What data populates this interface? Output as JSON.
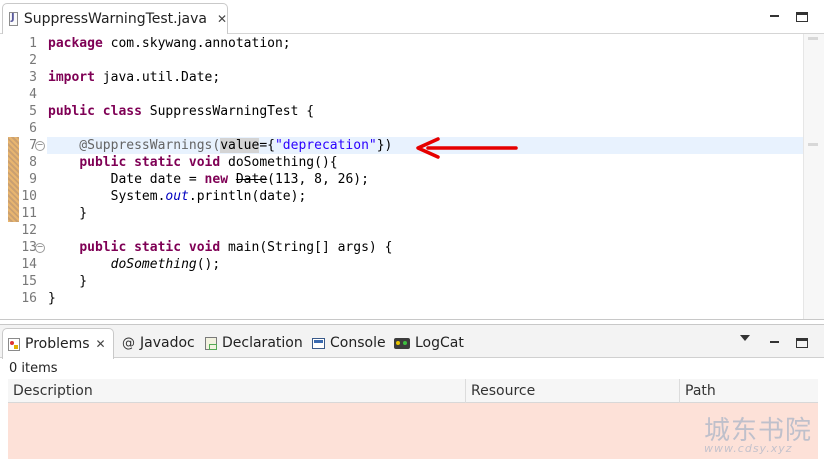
{
  "editor": {
    "tab_title": "SuppressWarningTest.java",
    "close_glyph": "✕",
    "lines": [
      {
        "n": "1"
      },
      {
        "n": "2"
      },
      {
        "n": "3"
      },
      {
        "n": "4"
      },
      {
        "n": "5"
      },
      {
        "n": "6"
      },
      {
        "n": "7"
      },
      {
        "n": "8"
      },
      {
        "n": "9"
      },
      {
        "n": "10"
      },
      {
        "n": "11"
      },
      {
        "n": "12"
      },
      {
        "n": "13"
      },
      {
        "n": "14"
      },
      {
        "n": "15"
      },
      {
        "n": "16"
      }
    ],
    "code": {
      "l1_kw": "package",
      "l1_rest": " com.skywang.annotation;",
      "l3_kw": "import",
      "l3_rest": " java.util.Date;",
      "l5_kw": "public class",
      "l5_rest": " SuppressWarningTest {",
      "l7_ann": "    @SuppressWarnings(",
      "l7_value": "value",
      "l7_eq": "={",
      "l7_str": "\"deprecation\"",
      "l7_end": "})",
      "l8_indent": "    ",
      "l8_kw": "public static void",
      "l8_rest": " doSomething(){",
      "l9_pre": "        Date date = ",
      "l9_kw": "new",
      "l9_sp": " ",
      "l9_strike": "Date",
      "l9_rest": "(113, 8, 26);",
      "l10_pre": "        System.",
      "l10_field": "out",
      "l10_rest": ".println(date);",
      "l11": "    }",
      "l13_indent": "    ",
      "l13_kw": "public static void",
      "l13_rest": " main(String[] args) {",
      "l14_indent": "        ",
      "l14_call": "doSomething",
      "l14_rest": "();",
      "l15": "    }",
      "l16": "}"
    },
    "colors": {
      "keyword": "#7f0055",
      "string": "#2a00ff",
      "annotation": "#646464",
      "current_line": "#e8f2fe"
    }
  },
  "annotation_arrow": {
    "color": "#e60000"
  },
  "views": {
    "tabs": [
      {
        "label": "Problems",
        "icon": "problems-icon"
      },
      {
        "label": "Javadoc",
        "icon": "javadoc-icon"
      },
      {
        "label": "Declaration",
        "icon": "declaration-icon"
      },
      {
        "label": "Console",
        "icon": "console-icon"
      },
      {
        "label": "LogCat",
        "icon": "logcat-icon"
      }
    ],
    "javadoc_glyph": "@",
    "close_glyph": "✕",
    "items_count": "0 items",
    "columns": [
      "Description",
      "Resource",
      "Path"
    ]
  },
  "watermark": {
    "text": "城东书院",
    "url": "www.cdsy.xyz"
  }
}
